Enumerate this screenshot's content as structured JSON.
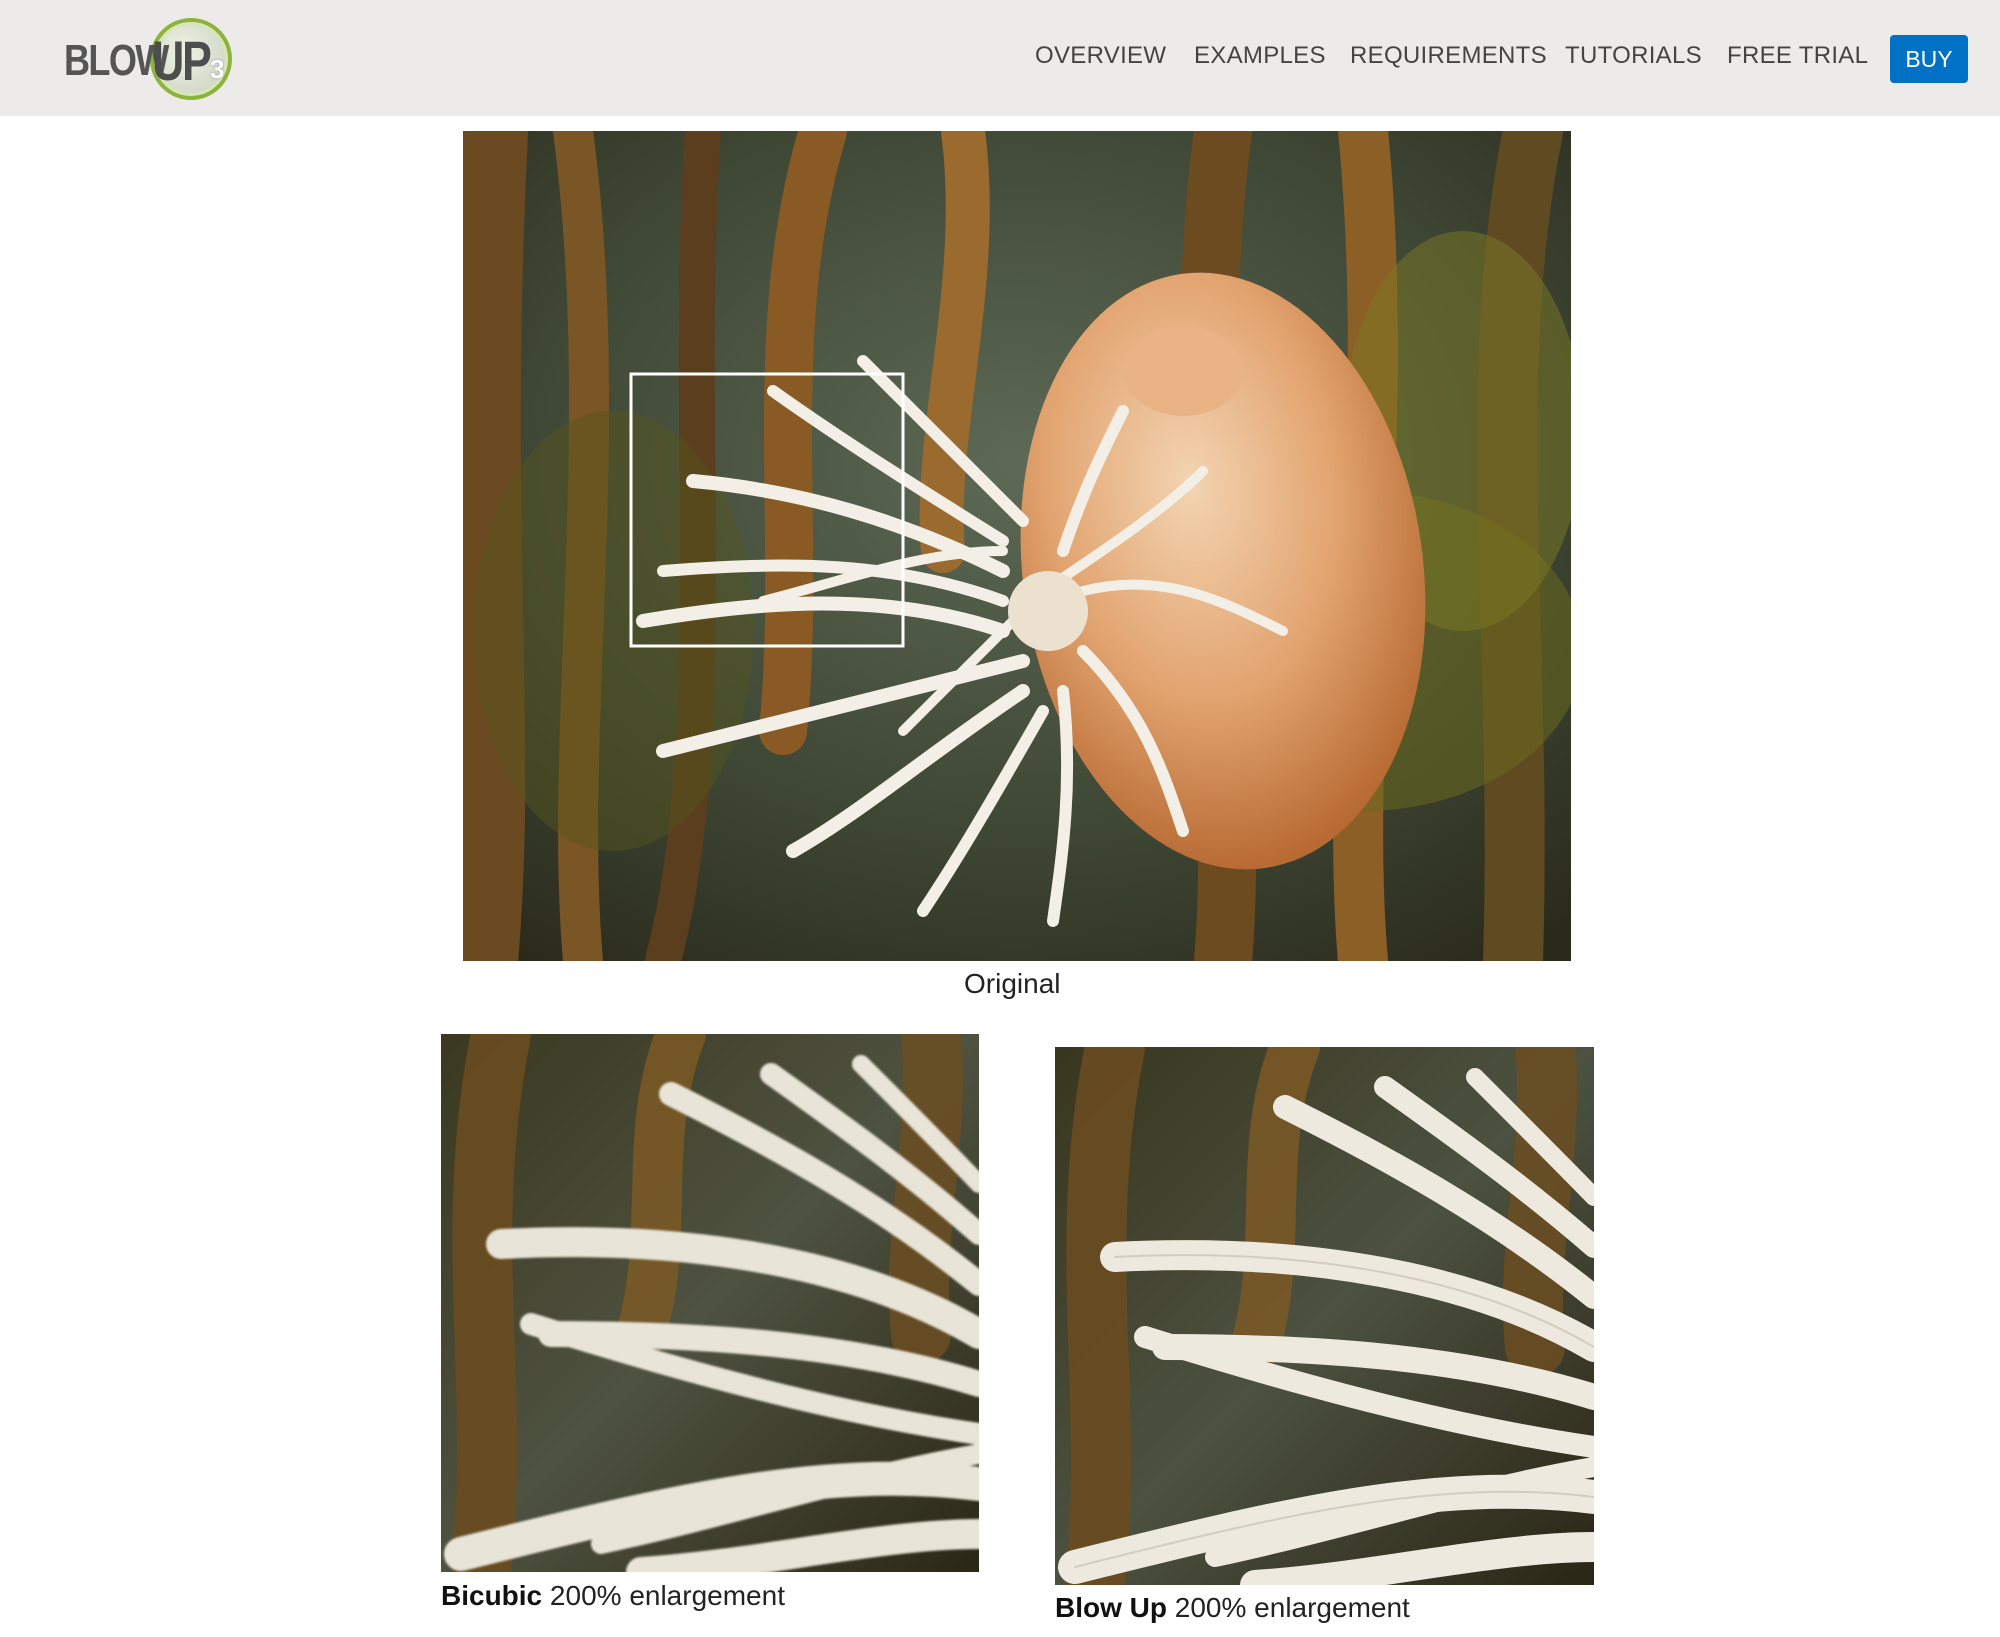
{
  "brand": {
    "logo_word": "BLOW",
    "logo_up": "UP",
    "logo_version": "3"
  },
  "nav": {
    "items": [
      {
        "label": "OVERVIEW"
      },
      {
        "label": "EXAMPLES"
      },
      {
        "label": "REQUIREMENTS"
      },
      {
        "label": "TUTORIALS"
      },
      {
        "label": "FREE TRIAL"
      }
    ],
    "buy_label": "BUY"
  },
  "colors": {
    "buy": "#0071c5",
    "header_bg": "#ecebea",
    "logo_green": "#8db33a"
  },
  "original": {
    "caption": "Original"
  },
  "bicubic": {
    "method": "Bicubic",
    "desc": " 200% enlargement"
  },
  "blowup": {
    "method": "Blow Up",
    "desc": " 200% enlargement"
  }
}
